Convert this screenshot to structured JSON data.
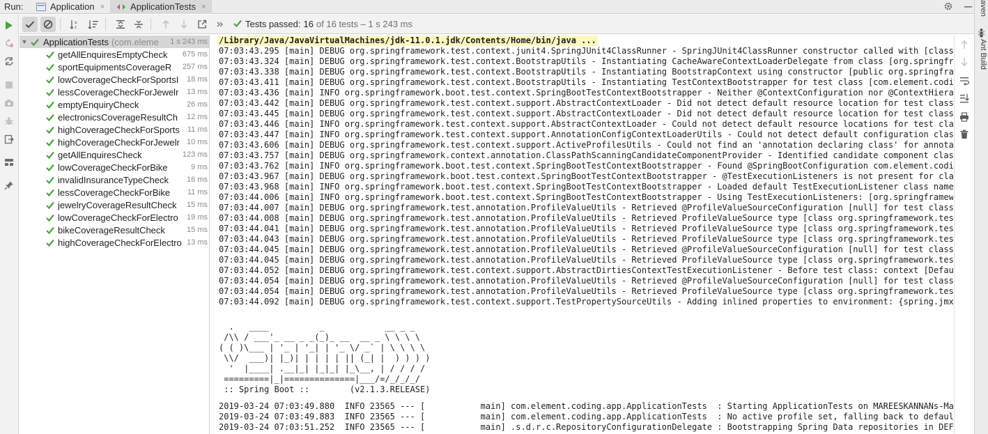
{
  "tabbar": {
    "run_label": "Run:",
    "tabs": [
      {
        "label": "Application",
        "icon": "spring-boot-app-icon"
      },
      {
        "label": "ApplicationTests",
        "icon": "junit-tests-icon"
      }
    ],
    "close_glyph": "×"
  },
  "right_strip": {
    "maven_label": "aven",
    "ant_label": "Ant Build"
  },
  "test_toolbar": {
    "status_label": "Tests passed:",
    "status_count": "16",
    "status_rest": "of 16 tests – 1 s 243 ms"
  },
  "tree": {
    "root": {
      "name": "ApplicationTests",
      "package": "(com.eleme",
      "time": "1 s 243 ms"
    },
    "tests": [
      {
        "name": "getAllEnquiresEmptyCheck",
        "time": "675 ms"
      },
      {
        "name": "sportEquipmentsCoverageR",
        "time": "257 ms"
      },
      {
        "name": "lowCoverageCheckForSportsI",
        "time": "18 ms"
      },
      {
        "name": "lessCoverageCheckForJewelr",
        "time": "13 ms"
      },
      {
        "name": "emptyEnquiryCheck",
        "time": "26 ms"
      },
      {
        "name": "electronicsCoverageResultCh",
        "time": "12 ms"
      },
      {
        "name": "highCoverageCheckForSports",
        "time": "11 ms"
      },
      {
        "name": "highCoverageCheckForJewelr",
        "time": "10 ms"
      },
      {
        "name": "getAllEnquiresCheck",
        "time": "123 ms"
      },
      {
        "name": "lowCoverageCheckForBike",
        "time": "9 ms"
      },
      {
        "name": "invalidInsuranceTypeCheck",
        "time": "16 ms"
      },
      {
        "name": "lessCoverageCheckForBike",
        "time": "11 ms"
      },
      {
        "name": "jewelryCoverageResultCheck",
        "time": "15 ms"
      },
      {
        "name": "lowCoverageCheckForElectro",
        "time": "19 ms"
      },
      {
        "name": "bikeCoverageResultCheck",
        "time": "15 ms"
      },
      {
        "name": "highCoverageCheckForElectro",
        "time": "13 ms"
      }
    ]
  },
  "console": {
    "command": "/Library/Java/JavaVirtualMachines/jdk-11.0.1.jdk/Contents/Home/bin/java ...",
    "log_lines": [
      "07:03:43.295 [main] DEBUG org.springframework.test.context.junit4.SpringJUnit4ClassRunner - SpringJUnit4ClassRunner constructor called with [class com.element.coding.app.ApplicationTests]",
      "07:03:43.324 [main] DEBUG org.springframework.test.context.BootstrapUtils - Instantiating CacheAwareContextLoaderDelegate from class [org.springframework.test.context.cache.DefaultCacheAwareContextLoaderDelegate]",
      "07:03:43.338 [main] DEBUG org.springframework.test.context.BootstrapUtils - Instantiating BootstrapContext using constructor [public org.springframework.test.context.support.DefaultBootstrapContext]",
      "07:03:43.411 [main] DEBUG org.springframework.test.context.BootstrapUtils - Instantiating TestContextBootstrapper for test class [com.element.coding.app.ApplicationTests]",
      "07:03:43.436 [main] INFO org.springframework.boot.test.context.SpringBootTestContextBootstrapper - Neither @ContextConfiguration nor @ContextHierarchy found",
      "07:03:43.442 [main] DEBUG org.springframework.test.context.support.AbstractContextLoader - Did not detect default resource location for test class [com.element.coding.app.ApplicationTests]",
      "07:03:43.445 [main] DEBUG org.springframework.test.context.support.AbstractContextLoader - Did not detect default resource location for test class [com.element.coding.app.ApplicationTests]",
      "07:03:43.446 [main] INFO org.springframework.test.context.support.AbstractContextLoader - Could not detect default resource locations for test class [com.element.coding.app.ApplicationTests]",
      "07:03:43.447 [main] INFO org.springframework.test.context.support.AnnotationConfigContextLoaderUtils - Could not detect default configuration classes for test class",
      "07:03:43.606 [main] DEBUG org.springframework.test.context.support.ActiveProfilesUtils - Could not find an 'annotation declaring class' for annotation type [ActiveProfiles]",
      "07:03:43.757 [main] DEBUG org.springframework.context.annotation.ClassPathScanningCandidateComponentProvider - Identified candidate component class: file",
      "07:03:43.762 [main] INFO org.springframework.boot.test.context.SpringBootTestContextBootstrapper - Found @SpringBootConfiguration com.element.coding.app.Application",
      "07:03:43.967 [main] DEBUG org.springframework.boot.test.context.SpringBootTestContextBootstrapper - @TestExecutionListeners is not present for class [com.element",
      "07:03:43.968 [main] INFO org.springframework.boot.test.context.SpringBootTestContextBootstrapper - Loaded default TestExecutionListener class names from location",
      "07:03:44.006 [main] INFO org.springframework.boot.test.context.SpringBootTestContextBootstrapper - Using TestExecutionListeners: [org.springframework.test.context",
      "07:03:44.007 [main] DEBUG org.springframework.test.annotation.ProfileValueUtils - Retrieved @ProfileValueSourceConfiguration [null] for test class [com.element",
      "07:03:44.008 [main] DEBUG org.springframework.test.annotation.ProfileValueUtils - Retrieved ProfileValueSource type [class org.springframework.test.annotation",
      "07:03:44.041 [main] DEBUG org.springframework.test.annotation.ProfileValueUtils - Retrieved ProfileValueSource type [class org.springframework.test.annotation",
      "07:03:44.043 [main] DEBUG org.springframework.test.annotation.ProfileValueUtils - Retrieved ProfileValueSource type [class org.springframework.test.annotation",
      "07:03:44.045 [main] DEBUG org.springframework.test.annotation.ProfileValueUtils - Retrieved @ProfileValueSourceConfiguration [null] for test class [com.element",
      "07:03:44.045 [main] DEBUG org.springframework.test.annotation.ProfileValueUtils - Retrieved ProfileValueSource type [class org.springframework.test.annotation",
      "07:03:44.052 [main] DEBUG org.springframework.test.context.support.AbstractDirtiesContextTestExecutionListener - Before test class: context [DefaultTestContext",
      "07:03:44.054 [main] DEBUG org.springframework.test.annotation.ProfileValueUtils - Retrieved @ProfileValueSourceConfiguration [null] for test class [com.element",
      "07:03:44.054 [main] DEBUG org.springframework.test.annotation.ProfileValueUtils - Retrieved ProfileValueSource type [class org.springframework.test.annotation",
      "07:03:44.092 [main] DEBUG org.springframework.test.context.support.TestPropertySourceUtils - Adding inlined properties to environment: {spring.jmx.enabled=false"
    ],
    "banner_lines": [
      "  .   ____          _            __ _ _",
      " /\\\\ / ___'_ __ _ _(_)_ __  __ _ \\ \\ \\ \\",
      "( ( )\\___ | '_ | '_| | '_ \\/ _` | \\ \\ \\ \\",
      " \\\\/  ___)| |_)| | | | | || (_| |  ) ) ) )",
      "  '  |____| .__|_| |_|_| |_\\__, | / / / /",
      " =========|_|==============|___/=/_/_/_/",
      " :: Spring Boot ::        (v2.1.3.RELEASE)"
    ],
    "app_lines": [
      "2019-03-24 07:03:49.880  INFO 23565 --- [           main] com.element.coding.app.ApplicationTests  : Starting ApplicationTests on MAREESKANNANs-MacBook-Pro.local",
      "2019-03-24 07:03:49.883  INFO 23565 --- [           main] com.element.coding.app.ApplicationTests  : No active profile set, falling back to default profiles: default",
      "2019-03-24 07:03:51.252  INFO 23565 --- [           main] .s.d.r.c.RepositoryConfigurationDelegate : Bootstrapping Spring Data repositories in DEFAULT mode."
    ]
  },
  "colors": {
    "pass_green": "#4aa33f",
    "run_green": "#4aa33f",
    "icon_gray": "#6e6e6e",
    "selected_row": "#d6d6d6"
  }
}
